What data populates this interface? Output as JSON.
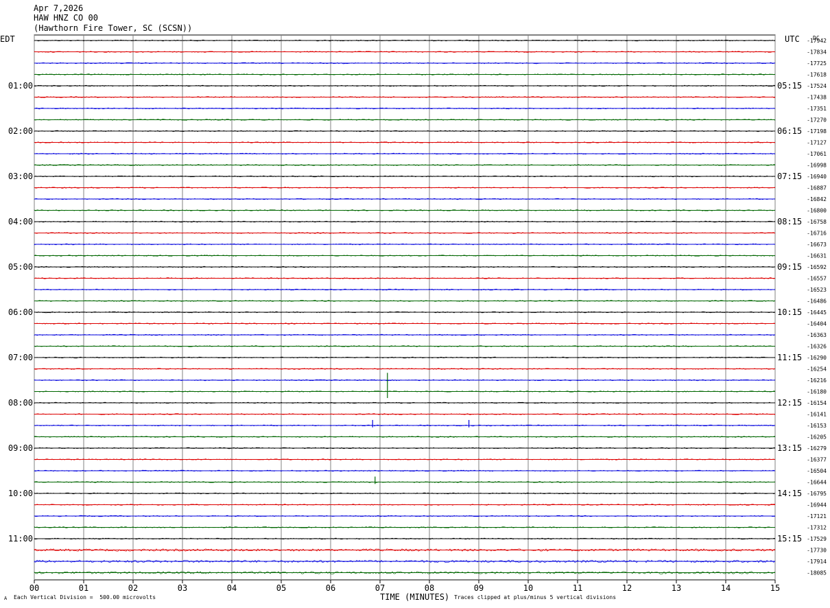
{
  "header": {
    "date": "Apr 7,2026",
    "station": "HAW HNZ CO 00",
    "location": "(Hawthorn Fire Tower, SC (SCSN))"
  },
  "corners": {
    "left_zone": "EDT",
    "right_zone": "UTC",
    "dc_label": "DC"
  },
  "footer": {
    "scale_note": "Each Vertical Division =  500.00 microvolts",
    "clip_note": "Traces clipped at plus/minus 5 vertical divisions",
    "corner_mark": "A"
  },
  "chart_data": {
    "type": "line",
    "title": "",
    "xlabel": "TIME (MINUTES)",
    "xlim": [
      0,
      15
    ],
    "x_ticks": [
      "00",
      "01",
      "02",
      "03",
      "04",
      "05",
      "06",
      "07",
      "08",
      "09",
      "10",
      "11",
      "12",
      "13",
      "14",
      "15"
    ],
    "grid": true,
    "trace_colors": [
      "#000000",
      "#dd0000",
      "#0000dd",
      "#006600"
    ],
    "left_hour_labels": [
      "01:00",
      "02:00",
      "03:00",
      "04:00",
      "05:00",
      "06:00",
      "07:00",
      "08:00",
      "09:00",
      "10:00",
      "11:00"
    ],
    "right_hour_labels": [
      "05:15",
      "06:15",
      "07:15",
      "08:15",
      "09:15",
      "10:15",
      "11:15",
      "12:15",
      "13:15",
      "14:15",
      "15:15"
    ],
    "dc_offsets": [
      -17942,
      -17834,
      -17725,
      -17618,
      -17524,
      -17438,
      -17351,
      -17270,
      -17198,
      -17127,
      -17061,
      -16998,
      -16940,
      -16887,
      -16842,
      -16800,
      -16758,
      -16716,
      -16673,
      -16631,
      -16592,
      -16557,
      -16523,
      -16486,
      -16445,
      -16404,
      -16363,
      -16326,
      -16290,
      -16254,
      -16216,
      -16180,
      -16154,
      -16141,
      -16153,
      -16205,
      -16279,
      -16377,
      -16504,
      -16644,
      -16795,
      -16944,
      -17121,
      -17312,
      -17529,
      -17730,
      -17914,
      -18085
    ],
    "events": [
      {
        "trace": 31,
        "minute": 7.15,
        "amplitude": 3.4
      },
      {
        "trace": 34,
        "minute": 6.85,
        "amplitude": 1.0
      },
      {
        "trace": 34,
        "minute": 8.8,
        "amplitude": 1.0
      },
      {
        "trace": 39,
        "minute": 6.9,
        "amplitude": 1.0
      }
    ]
  }
}
